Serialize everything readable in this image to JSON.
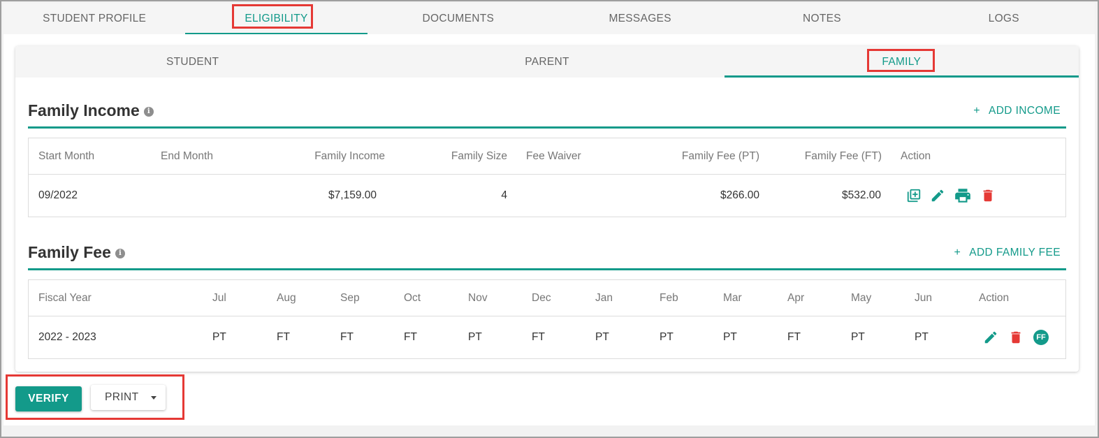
{
  "top_tabs": [
    {
      "label": "STUDENT PROFILE"
    },
    {
      "label": "ELIGIBILITY"
    },
    {
      "label": "DOCUMENTS"
    },
    {
      "label": "MESSAGES"
    },
    {
      "label": "NOTES"
    },
    {
      "label": "LOGS"
    }
  ],
  "top_tabs_active": "ELIGIBILITY",
  "sub_tabs": [
    {
      "label": "STUDENT"
    },
    {
      "label": "PARENT"
    },
    {
      "label": "FAMILY"
    }
  ],
  "sub_tabs_active": "FAMILY",
  "family_income": {
    "title": "Family Income",
    "add_label": "ADD INCOME",
    "plus": "+",
    "columns": [
      "Start Month",
      "End Month",
      "Family Income",
      "Family Size",
      "Fee Waiver",
      "Family Fee (PT)",
      "Family Fee (FT)",
      "Action"
    ],
    "rows": [
      {
        "start_month": "09/2022",
        "end_month": "",
        "family_income": "$7,159.00",
        "family_size": "4",
        "fee_waiver": "",
        "fee_pt": "$266.00",
        "fee_ft": "$532.00",
        "actions": [
          "add-box-icon",
          "pencil-icon",
          "printer-icon",
          "trash-icon"
        ]
      }
    ]
  },
  "family_fee": {
    "title": "Family Fee",
    "add_label": "ADD FAMILY FEE",
    "plus": "+",
    "columns": [
      "Fiscal Year",
      "Jul",
      "Aug",
      "Sep",
      "Oct",
      "Nov",
      "Dec",
      "Jan",
      "Feb",
      "Mar",
      "Apr",
      "May",
      "Jun",
      "Action"
    ],
    "rows": [
      {
        "fiscal_year": "2022 - 2023",
        "months": [
          "PT",
          "FT",
          "FT",
          "FT",
          "PT",
          "FT",
          "PT",
          "PT",
          "PT",
          "FT",
          "PT",
          "PT"
        ],
        "actions": [
          "pencil-icon",
          "trash-icon",
          "ff-badge-icon"
        ],
        "badge": "FF"
      }
    ]
  },
  "buttons": {
    "verify": "VERIFY",
    "print": "PRINT"
  },
  "colors": {
    "accent": "#139a8a",
    "danger": "#e53935",
    "highlight": "#e53935"
  }
}
